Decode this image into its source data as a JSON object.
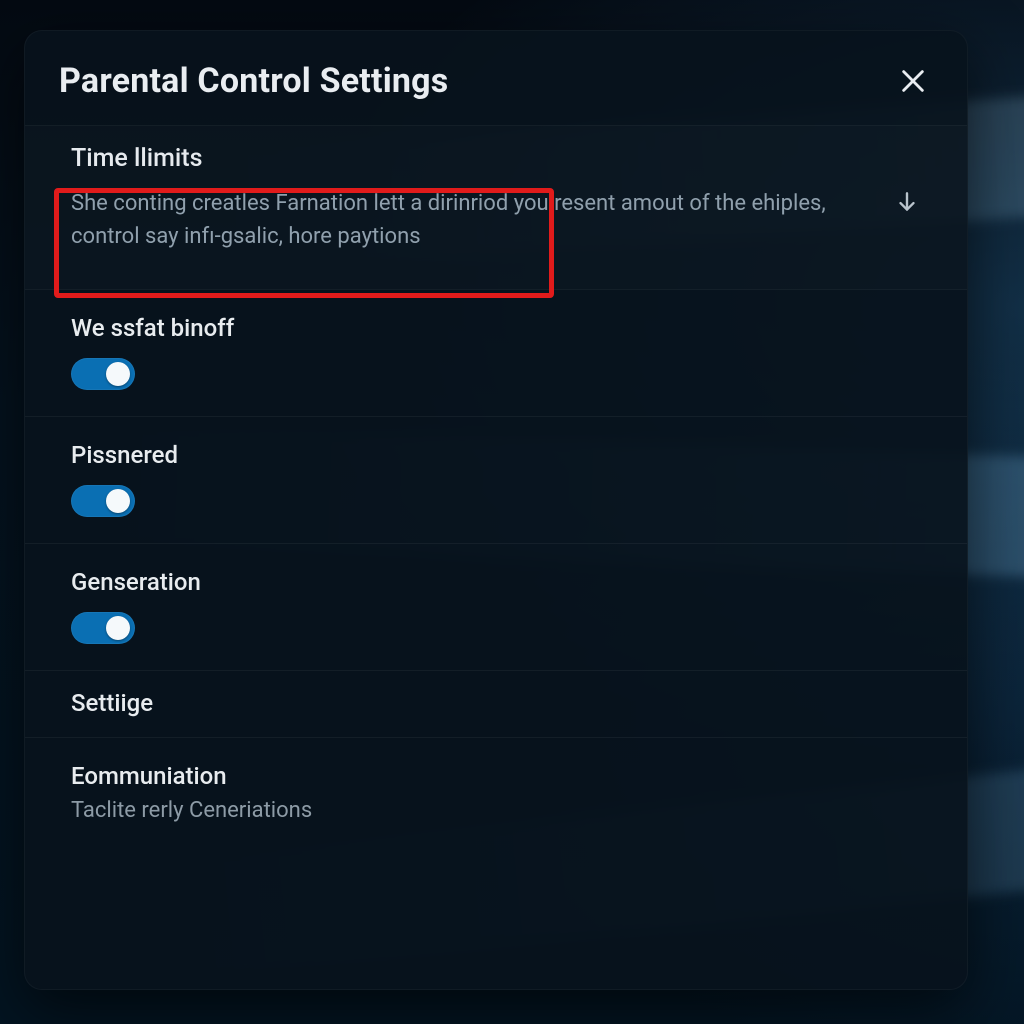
{
  "header": {
    "title": "Parental Control Settings"
  },
  "timelimits": {
    "title": "Time llimits",
    "description": "She conting creatles Farnation lett a dirinriod you resent amout of the ehiples, control say infı-gsalic, hore paytions"
  },
  "toggles": [
    {
      "label": "We ssfat binoff",
      "on": true
    },
    {
      "label": "Pissnered",
      "on": true
    },
    {
      "label": "Genseration",
      "on": true
    }
  ],
  "settiige": {
    "label": "Settiige"
  },
  "communication": {
    "label": "Eommuniation",
    "sub": "Taclite rerly Ceneriations"
  },
  "colors": {
    "accent": "#0a6fb3",
    "annotation": "#e11b1b"
  }
}
